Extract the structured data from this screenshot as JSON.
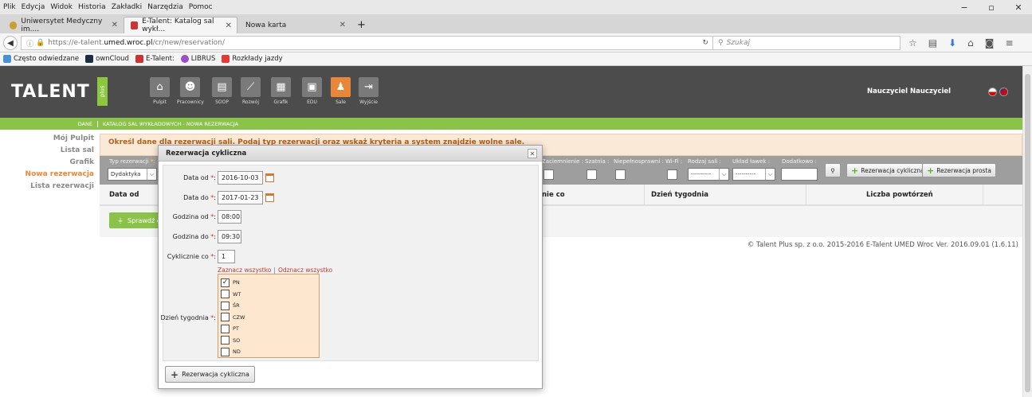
{
  "browser": {
    "menu": [
      "Plik",
      "Edycja",
      "Widok",
      "Historia",
      "Zakładki",
      "Narzędzia",
      "Pomoc"
    ],
    "tabs": [
      "Uniwersytet Medyczny im....",
      "E-Talent: Katalog sal wykł...",
      "Nowa karta"
    ],
    "url_prefix": "https://e-talent.",
    "url_host": "umed.wroc.pl",
    "url_path": "/cr/new/reservation/",
    "search_placeholder": "Szukaj",
    "bookmarks": [
      "Często odwiedzane",
      "ownCloud",
      "E-Talent:",
      "LIBRUS",
      "Rozkłady jazdy"
    ]
  },
  "app": {
    "logo": "TALENT",
    "logo_plus": "plus",
    "modules": [
      {
        "label": "Pulpit",
        "icon": "home-icon"
      },
      {
        "label": "Pracownicy",
        "icon": "users-icon"
      },
      {
        "label": "SOOP",
        "icon": "document-icon"
      },
      {
        "label": "Rozwój",
        "icon": "chart-icon"
      },
      {
        "label": "Grafik",
        "icon": "calendar-icon"
      },
      {
        "label": "EDU",
        "icon": "edu-icon"
      },
      {
        "label": "Sale",
        "icon": "classroom-icon"
      },
      {
        "label": "Wyjście",
        "icon": "exit-icon"
      }
    ],
    "user": "Nauczyciel Nauczyciel",
    "breadcrumb_left": "DANE",
    "breadcrumb_right": "KATALOG SAL WYKŁADOWYCH - NOWA REZERWACJA"
  },
  "sidebar": {
    "items": [
      "Mój Pulpit",
      "Lista sal",
      "Grafik",
      "Nowa rezerwacja",
      "Lista rezerwacji"
    ]
  },
  "content": {
    "info": "Określ dane dla rezerwacji sali. Podaj typ rezerwacji oraz wskaż kryteria a system znajdzie wolne sale.",
    "filters": {
      "typ_label": "Typ rezerwacji",
      "typ_value": "Dydaktyka",
      "zaciemnienie": "Zaciemnienie :",
      "szatnia": "Szatnia :",
      "niepelnosprawni": "Niepełnosprawni :",
      "wifi": "Wi-Fi :",
      "rodzaj_sali": "Rodzaj sali :",
      "rodzaj_value": "----------",
      "uklad_lawek": "Układ ławek :",
      "uklad_value": "----------",
      "dodatkowo": "Dodatkowo :",
      "btn_cykliczna": "Rezerwacja cykliczna",
      "btn_prosta": "Rezerwacja prosta"
    },
    "table_headers": {
      "data_od": "Data od",
      "co": "nie co",
      "dzien": "Dzień tygodnia",
      "liczba": "Liczba powtórzeń"
    },
    "check_btn": "Sprawdź do"
  },
  "footer": "© Talent Plus sp. z o.o. 2015-2016   E-Talent UMED Wroc Ver. 2016.09.01 (1.6.11)",
  "modal": {
    "title": "Rezerwacja cykliczna",
    "fields": {
      "data_od_label": "Data od",
      "data_od": "2016-10-03",
      "data_do_label": "Data do",
      "data_do": "2017-01-23",
      "godzina_od_label": "Godzina od",
      "godzina_od": "08:00",
      "godzina_do_label": "Godzina do",
      "godzina_do": "09:30",
      "cyklicznie_label": "Cyklicznie co",
      "cyklicznie": "1",
      "dzien_label": "Dzień tygodnia"
    },
    "select_all": "Zaznacz wszystko",
    "deselect_all": "Odznacz wszystko",
    "days": [
      {
        "label": "PN",
        "checked": true
      },
      {
        "label": "WT",
        "checked": false
      },
      {
        "label": "ŚR",
        "checked": false
      },
      {
        "label": "CZW",
        "checked": false
      },
      {
        "label": "PT",
        "checked": false
      },
      {
        "label": "SO",
        "checked": false
      },
      {
        "label": "ND",
        "checked": false
      }
    ],
    "submit": "Rezerwacja cykliczna"
  },
  "colors": {
    "accent_green": "#8bc34a",
    "accent_orange": "#e8873a",
    "header_gray": "#4c4c4c"
  }
}
